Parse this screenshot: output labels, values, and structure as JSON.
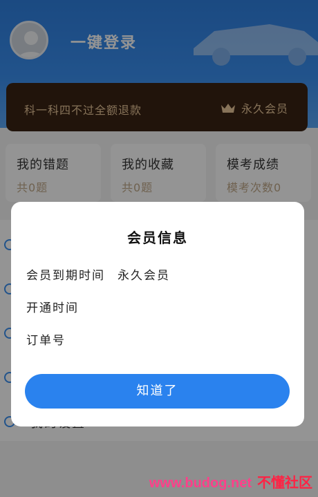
{
  "header": {
    "login_label": "一键登录"
  },
  "vip_banner": {
    "refund_text": "科一科四不过全额退款",
    "badge_label": "永久会员",
    "badge_icon": "crown-icon"
  },
  "stats": [
    {
      "title": "我的错题",
      "subtitle": "共0题"
    },
    {
      "title": "我的收藏",
      "subtitle": "共0题"
    },
    {
      "title": "模考成绩",
      "subtitle": "模考次数0"
    }
  ],
  "menu": {
    "items": [
      {
        "label": ""
      },
      {
        "label": ""
      },
      {
        "label": ""
      },
      {
        "label": ""
      },
      {
        "label": "我的设置"
      }
    ]
  },
  "dialog": {
    "title": "会员信息",
    "rows": [
      {
        "label": "会员到期时间",
        "value": "永久会员"
      },
      {
        "label": "开通时间",
        "value": ""
      },
      {
        "label": "订单号",
        "value": ""
      }
    ],
    "ok_label": "知道了"
  },
  "watermark": {
    "url": "www.budog.net",
    "site": "不懂社区"
  },
  "colors": {
    "primary": "#2a82ee",
    "vip_bg": "#3a2314",
    "vip_text": "#e8c79a",
    "watermark": "#ff3f8a"
  }
}
